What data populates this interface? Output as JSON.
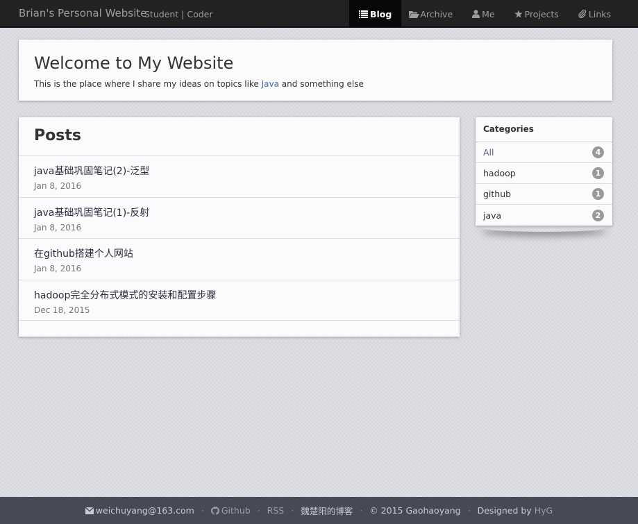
{
  "navbar": {
    "brand": "Brian's Personal Website",
    "tagline": "Student | Coder",
    "items": [
      {
        "label": "Blog",
        "icon": "list-icon",
        "active": true
      },
      {
        "label": "Archive",
        "icon": "folder-open-icon",
        "active": false
      },
      {
        "label": "Me",
        "icon": "user-icon",
        "active": false
      },
      {
        "label": "Projects",
        "icon": "star-icon",
        "active": false
      },
      {
        "label": "Links",
        "icon": "paperclip-icon",
        "active": false
      }
    ]
  },
  "jumbotron": {
    "title": "Welcome to My Website",
    "text_before": "This is the place where I share my ideas on topics like ",
    "link": "Java",
    "text_after": " and something else"
  },
  "posts": {
    "heading": "Posts",
    "items": [
      {
        "title": "java基础巩固笔记(2)-泛型",
        "date": "Jan 8, 2016"
      },
      {
        "title": "java基础巩固笔记(1)-反射",
        "date": "Jan 8, 2016"
      },
      {
        "title": "在github搭建个人网站",
        "date": "Jan 8, 2016"
      },
      {
        "title": "hadoop完全分布式模式的安装和配置步骤",
        "date": "Dec 18, 2015"
      }
    ]
  },
  "categories": {
    "heading": "Categories",
    "items": [
      {
        "name": "All",
        "count": "4"
      },
      {
        "name": "hadoop",
        "count": "1"
      },
      {
        "name": "github",
        "count": "1"
      },
      {
        "name": "java",
        "count": "2"
      }
    ]
  },
  "footer": {
    "email": "weichuyang@163.com",
    "github": "Github",
    "rss": "RSS",
    "blog": "魏楚阳的博客",
    "copyright": "© 2015 Gaohaoyang",
    "designed_by": "Designed by",
    "designer": "HyG",
    "separator": "·"
  }
}
